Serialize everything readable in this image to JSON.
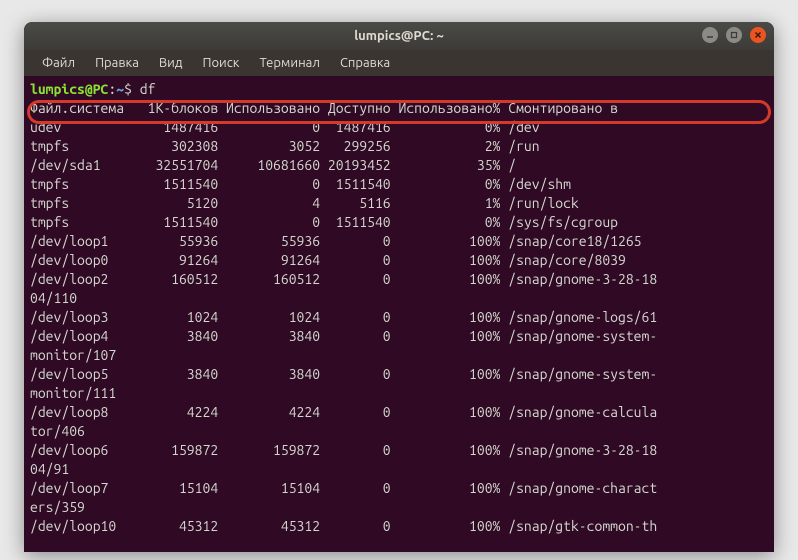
{
  "window": {
    "title": "lumpics@PC: ~"
  },
  "menu": {
    "file": "Файл",
    "edit": "Правка",
    "view": "Вид",
    "search": "Поиск",
    "terminal": "Терминал",
    "help": "Справка"
  },
  "prompt": {
    "userhost": "lumpics@PC",
    "sep": ":",
    "path": "~",
    "dollar": "$",
    "command": "df"
  },
  "header": {
    "fs": "Файл.система",
    "blocks": "1K-блоков",
    "used": "Использовано",
    "avail": "Доступно",
    "usepct": "Использовано%",
    "mounted": "Смонтировано в"
  },
  "rows": [
    {
      "fs": "udev",
      "blocks": "1487416",
      "used": "0",
      "avail": "1487416",
      "usepct": "0%",
      "mnt": "/dev"
    },
    {
      "fs": "tmpfs",
      "blocks": "302308",
      "used": "3052",
      "avail": "299256",
      "usepct": "2%",
      "mnt": "/run"
    },
    {
      "fs": "/dev/sda1",
      "blocks": "32551704",
      "used": "10681660",
      "avail": "20193452",
      "usepct": "35%",
      "mnt": "/"
    },
    {
      "fs": "tmpfs",
      "blocks": "1511540",
      "used": "0",
      "avail": "1511540",
      "usepct": "0%",
      "mnt": "/dev/shm"
    },
    {
      "fs": "tmpfs",
      "blocks": "5120",
      "used": "4",
      "avail": "5116",
      "usepct": "1%",
      "mnt": "/run/lock"
    },
    {
      "fs": "tmpfs",
      "blocks": "1511540",
      "used": "0",
      "avail": "1511540",
      "usepct": "0%",
      "mnt": "/sys/fs/cgroup"
    },
    {
      "fs": "/dev/loop1",
      "blocks": "55936",
      "used": "55936",
      "avail": "0",
      "usepct": "100%",
      "mnt": "/snap/core18/1265"
    },
    {
      "fs": "/dev/loop0",
      "blocks": "91264",
      "used": "91264",
      "avail": "0",
      "usepct": "100%",
      "mnt": "/snap/core/8039"
    },
    {
      "fs": "/dev/loop2",
      "blocks": "160512",
      "used": "160512",
      "avail": "0",
      "usepct": "100%",
      "mnt": "/snap/gnome-3-28-18",
      "wrap": "04/110"
    },
    {
      "fs": "/dev/loop3",
      "blocks": "1024",
      "used": "1024",
      "avail": "0",
      "usepct": "100%",
      "mnt": "/snap/gnome-logs/61"
    },
    {
      "fs": "/dev/loop4",
      "blocks": "3840",
      "used": "3840",
      "avail": "0",
      "usepct": "100%",
      "mnt": "/snap/gnome-system-",
      "wrap": "monitor/107"
    },
    {
      "fs": "/dev/loop5",
      "blocks": "3840",
      "used": "3840",
      "avail": "0",
      "usepct": "100%",
      "mnt": "/snap/gnome-system-",
      "wrap": "monitor/111"
    },
    {
      "fs": "/dev/loop8",
      "blocks": "4224",
      "used": "4224",
      "avail": "0",
      "usepct": "100%",
      "mnt": "/snap/gnome-calcula",
      "wrap": "tor/406"
    },
    {
      "fs": "/dev/loop6",
      "blocks": "159872",
      "used": "159872",
      "avail": "0",
      "usepct": "100%",
      "mnt": "/snap/gnome-3-28-18",
      "wrap": "04/91"
    },
    {
      "fs": "/dev/loop7",
      "blocks": "15104",
      "used": "15104",
      "avail": "0",
      "usepct": "100%",
      "mnt": "/snap/gnome-charact",
      "wrap": "ers/359"
    },
    {
      "fs": "/dev/loop10",
      "blocks": "45312",
      "used": "45312",
      "avail": "0",
      "usepct": "100%",
      "mnt": "/snap/gtk-common-th"
    }
  ]
}
